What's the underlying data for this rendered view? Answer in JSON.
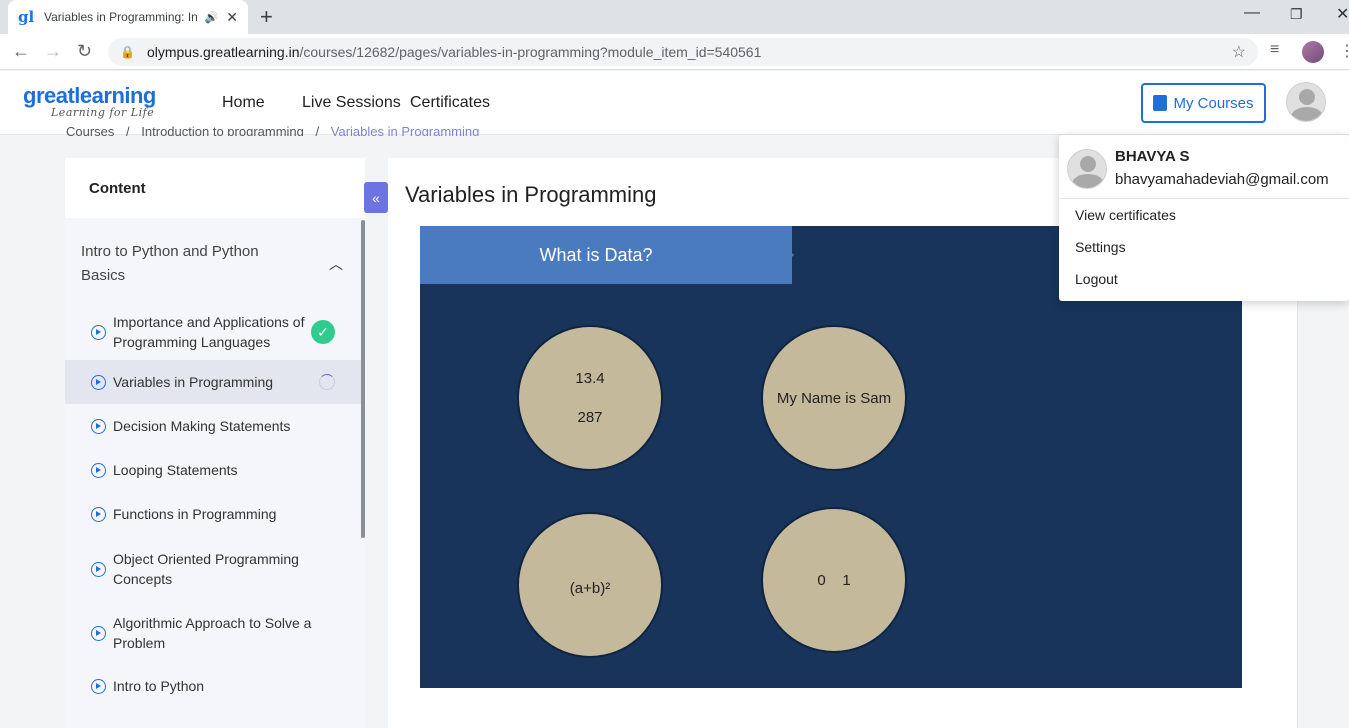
{
  "browser": {
    "tab_title": "Variables in Programming: In",
    "favicon": "gl",
    "url_host": "olympus.greatlearning.in",
    "url_path": "/courses/12682/pages/variables-in-programming?module_item_id=540561"
  },
  "site": {
    "logo_main": "greatlearning",
    "logo_tagline": "Learning for Life",
    "nav": [
      "Home",
      "Live Sessions",
      "Certificates"
    ],
    "my_courses": "My Courses"
  },
  "breadcrumb": {
    "items": [
      "Courses",
      "Introduction to programming",
      "Variables in Programming"
    ],
    "separator": "/"
  },
  "sidebar": {
    "title": "Content",
    "module": "Intro to Python and Python Basics",
    "lessons": [
      {
        "label": "Importance and Applications of Programming Languages",
        "status": "complete"
      },
      {
        "label": "Variables in Programming",
        "status": "in-progress"
      },
      {
        "label": "Decision Making Statements",
        "status": ""
      },
      {
        "label": "Looping Statements",
        "status": ""
      },
      {
        "label": "Functions in Programming",
        "status": ""
      },
      {
        "label": "Object Oriented Programming Concepts",
        "status": ""
      },
      {
        "label": "Algorithmic Approach to Solve a Problem",
        "status": ""
      },
      {
        "label": "Intro to Python",
        "status": ""
      }
    ]
  },
  "main": {
    "title": "Variables in Programming",
    "slide": {
      "banner": "What is Data?",
      "circles": [
        {
          "line1": "13.4",
          "line2": "287"
        },
        {
          "line1": "My Name is Sam",
          "line2": ""
        },
        {
          "line1": "(a+b)²",
          "line2": ""
        },
        {
          "line1": "0    1",
          "line2": ""
        }
      ]
    }
  },
  "user_menu": {
    "name": "BHAVYA S",
    "email": "bhavyamahadeviah@gmail.com",
    "items": [
      "View certificates",
      "Settings",
      "Logout"
    ]
  },
  "colors": {
    "brand": "#1e6fd9",
    "slide_bg": "#18345b",
    "banner": "#4a7bbf",
    "circle": "#c4b99a",
    "complete": "#2ecc8f",
    "collapse": "#6b74e0"
  }
}
